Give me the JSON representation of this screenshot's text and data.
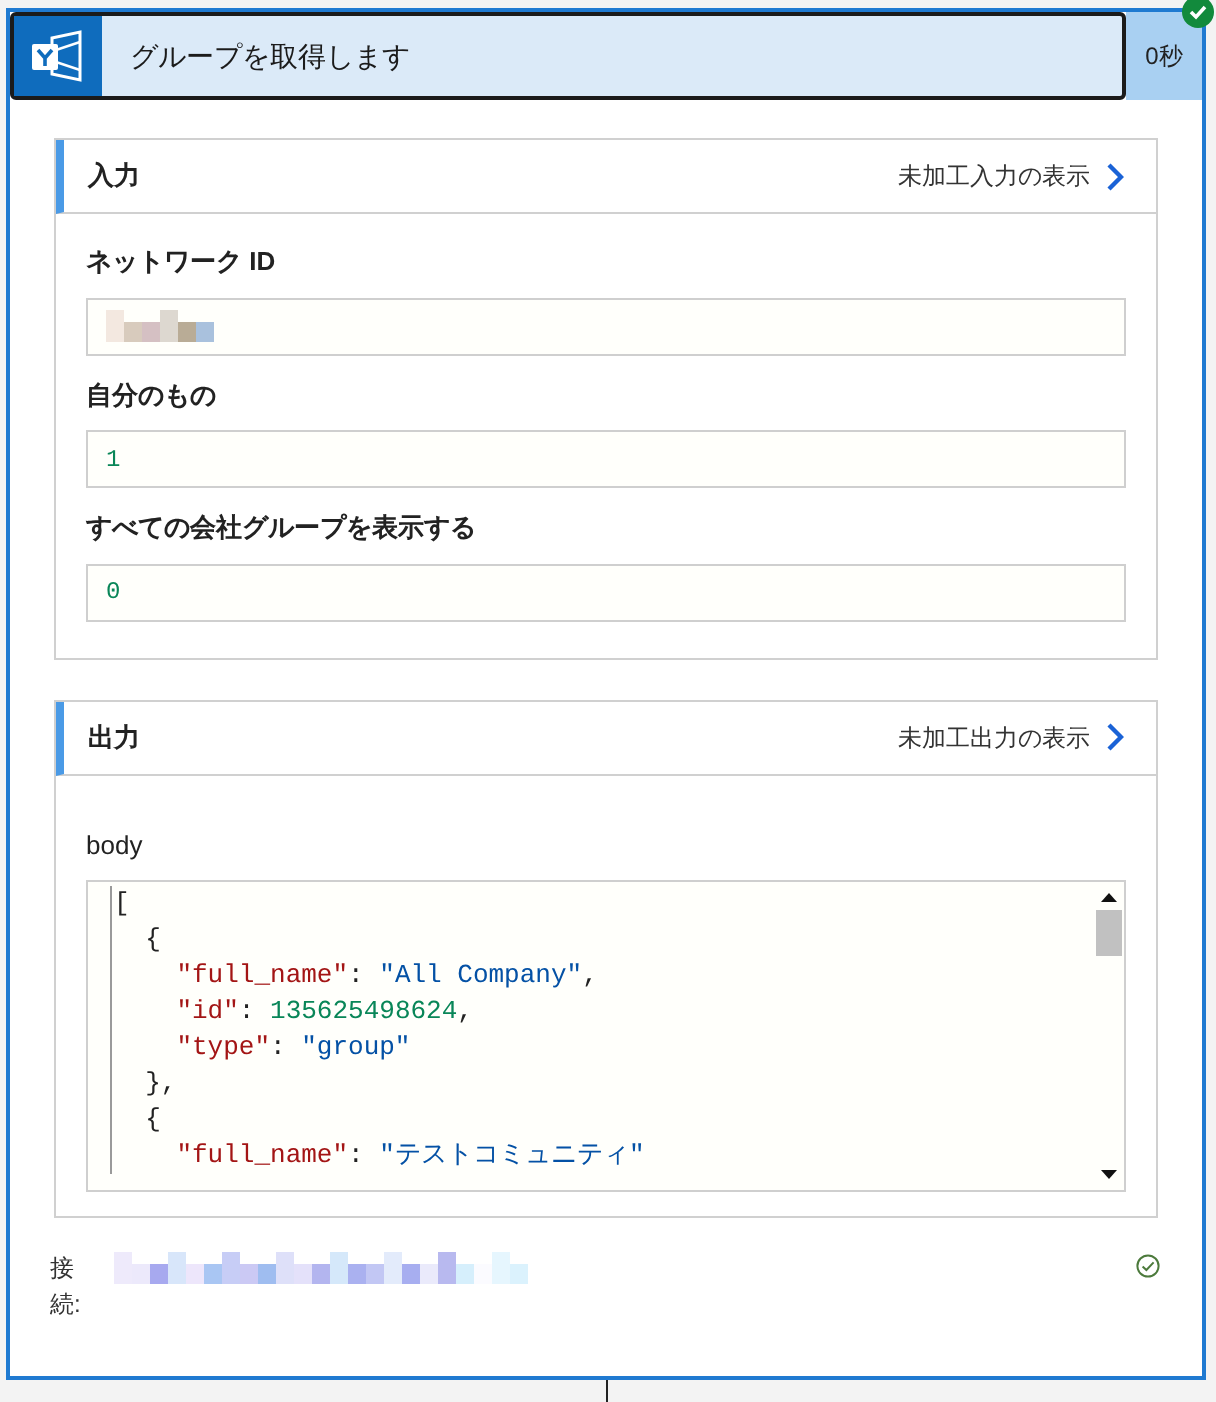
{
  "action": {
    "title": "グループを取得します",
    "duration": "0秒",
    "succeeded": true
  },
  "inputs": {
    "title": "入力",
    "link": "未加工入力の表示",
    "fields": [
      {
        "label": "ネットワーク ID",
        "kind": "redacted"
      },
      {
        "label": "自分のもの",
        "kind": "value",
        "value": "1"
      },
      {
        "label": "すべての会社グループを表示する",
        "kind": "value",
        "value": "0"
      }
    ]
  },
  "outputs": {
    "title": "出力",
    "link": "未加工出力の表示",
    "body_label": "body",
    "code_lines": [
      [
        {
          "kind": "punct",
          "text": "["
        }
      ],
      [
        {
          "kind": "punct",
          "text": "  {"
        }
      ],
      [
        {
          "kind": "key",
          "text": "    \"full_name\""
        },
        {
          "kind": "punct",
          "text": ": "
        },
        {
          "kind": "string",
          "text": "\"All Company\""
        },
        {
          "kind": "punct",
          "text": ","
        }
      ],
      [
        {
          "kind": "key",
          "text": "    \"id\""
        },
        {
          "kind": "punct",
          "text": ": "
        },
        {
          "kind": "number",
          "text": "135625498624"
        },
        {
          "kind": "punct",
          "text": ","
        }
      ],
      [
        {
          "kind": "key",
          "text": "    \"type\""
        },
        {
          "kind": "punct",
          "text": ": "
        },
        {
          "kind": "string",
          "text": "\"group\""
        }
      ],
      [
        {
          "kind": "punct",
          "text": "  },"
        }
      ],
      [
        {
          "kind": "punct",
          "text": "  {"
        }
      ],
      [
        {
          "kind": "key",
          "text": "    \"full_name\""
        },
        {
          "kind": "punct",
          "text": ": "
        },
        {
          "kind": "string",
          "text": "\"テストコミュニティ\""
        }
      ]
    ]
  },
  "connection": {
    "label": "接続:",
    "status_ok": true
  }
}
